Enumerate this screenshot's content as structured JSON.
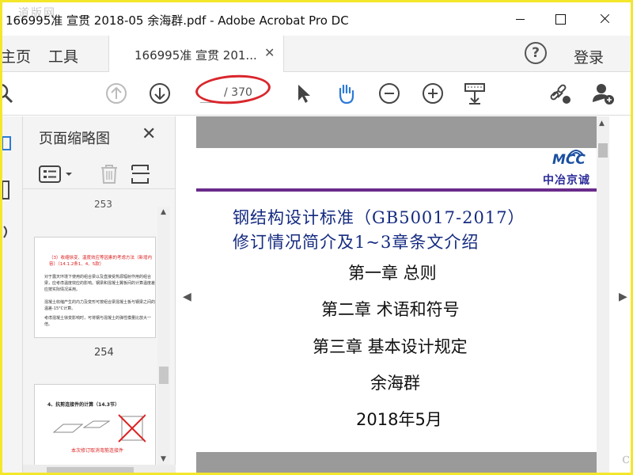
{
  "window": {
    "title": "166995准 宣贯 2018-05 余海群.pdf - Adobe Acrobat Pro DC",
    "watermark": "道版网"
  },
  "tabs": {
    "home_label": "主页",
    "tools_label": "工具",
    "doc_tab_label": "166995准 宣贯 201...",
    "help_label": "?",
    "login_label": "登录"
  },
  "toolbar": {
    "page_current": "",
    "page_total": "/ 370"
  },
  "thumb_panel": {
    "title": "页面缩略图",
    "page_above": "253",
    "thumb1_num": "254",
    "thumb1_heading": "（3）收缩徐变、温度效应等因素的考虑方法（新增内容）（14.1.2条1、4、5款）",
    "thumb1_bullets": [
      "对于露天环境下使用的组合梁以及直接受热源辐射作用的组合梁，应考虑温度效应的影响。钢梁和混凝土翼板间的计算温度差应按实际情况采用。",
      "混凝土收缩产生的内力及变形可按组合梁混凝土板与钢梁之间的温差-15°C计算。",
      "考虑混凝土徐变影响时，可将钢与混凝土的弹性模量比放大一倍。"
    ],
    "thumb2_heading": "4、抗剪连接件的计算（14.3节）",
    "thumb2_foot": "本次修订取消弯筋连接件"
  },
  "document": {
    "logo": "MCC",
    "logo_cn": "中冶京诚",
    "title_line1": "钢结构设计标准（GB50017-2017）",
    "title_line2": "修订情况简介及1~3章条文介绍",
    "chapter1": "第一章 总则",
    "chapter2": "第二章 术语和符号",
    "chapter3": "第三章 基本设计规定",
    "author": "余海群",
    "date": "2018年5月"
  },
  "corner_watermark": "com"
}
